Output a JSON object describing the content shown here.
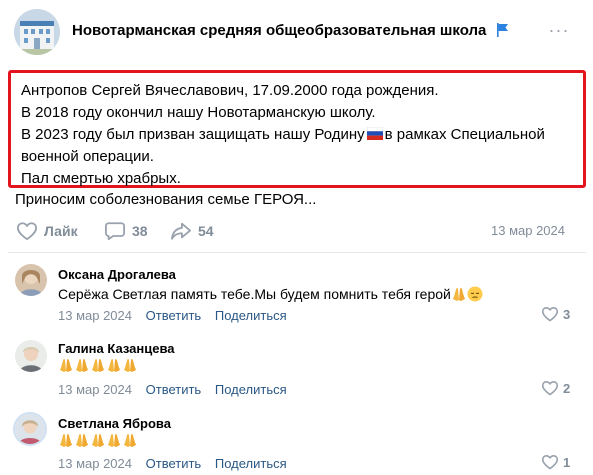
{
  "group": {
    "name": "Новотарманская средняя общеобразовательная школа",
    "more": "···"
  },
  "post": {
    "lines": [
      "Антропов Сергей Вячеславович, 17.09.2000 года рождения.",
      "В 2018 году окончил нашу Новотарманскую школу.",
      "В 2023 году был призван защищать нашу Родину",
      "в рамках Специальной",
      "военной операции.",
      "Пал смертью храбрых."
    ],
    "extra_line": "Приносим соболезнования семье ГЕРОЯ...",
    "like_label": "Лайк",
    "comments_count": "38",
    "shares_count": "54",
    "date": "13 мар 2024"
  },
  "comments": [
    {
      "author": "Оксана Дрогалева",
      "text": "Серёжа Светлая память тебе.Мы будем помнить тебя герой",
      "date": "13 мар 2024",
      "reply": "Ответить",
      "share": "Поделиться",
      "likes": "3",
      "emojis": [
        "folded-hands",
        "pensive-face"
      ]
    },
    {
      "author": "Галина Казанцева",
      "text": "",
      "date": "13 мар 2024",
      "reply": "Ответить",
      "share": "Поделиться",
      "likes": "2",
      "emojis": [
        "folded-hands",
        "folded-hands",
        "folded-hands",
        "folded-hands",
        "folded-hands"
      ]
    },
    {
      "author": "Светлана Яброва",
      "text": "",
      "date": "13 мар 2024",
      "reply": "Ответить",
      "share": "Поделиться",
      "likes": "1",
      "emojis": [
        "folded-hands",
        "folded-hands",
        "folded-hands",
        "folded-hands",
        "folded-hands"
      ]
    }
  ],
  "colors": {
    "highlight_border": "#e3141e",
    "link": "#2a5885",
    "muted": "#818c99"
  }
}
